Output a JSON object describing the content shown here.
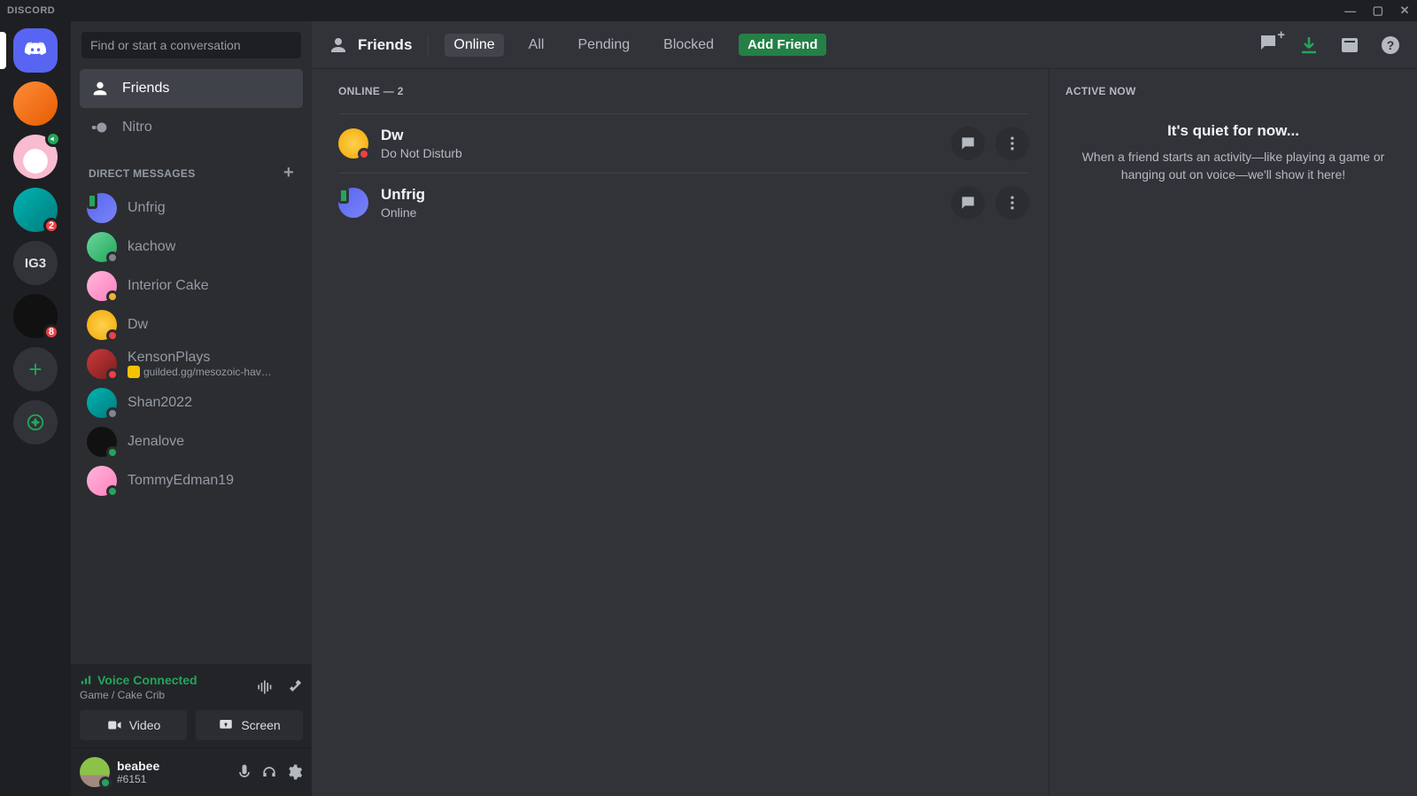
{
  "titlebar": {
    "brand": "DISCORD"
  },
  "search": {
    "placeholder": "Find or start a conversation"
  },
  "sidebar": {
    "friends_label": "Friends",
    "nitro_label": "Nitro",
    "dm_header": "DIRECT MESSAGES",
    "dms": [
      {
        "name": "Unfrig",
        "status": "mobile",
        "av": "av-blue"
      },
      {
        "name": "kachow",
        "status": "offline",
        "av": "av-green"
      },
      {
        "name": "Interior Cake",
        "status": "idle",
        "av": "av-pink"
      },
      {
        "name": "Dw",
        "status": "dnd",
        "av": "av-yellow"
      },
      {
        "name": "KensonPlays",
        "status": "dnd",
        "sub": "guilded.gg/mesozoic-hav…",
        "av": "av-red"
      },
      {
        "name": "Shan2022",
        "status": "offline",
        "av": "av-teal"
      },
      {
        "name": "Jenalove",
        "status": "online",
        "av": "av-dark"
      },
      {
        "name": "TommyEdman19",
        "status": "online",
        "av": "av-pink"
      }
    ]
  },
  "servers": [
    {
      "kind": "home",
      "active": true
    },
    {
      "kind": "icon",
      "av": "av-orange"
    },
    {
      "kind": "icon",
      "av": "av-cake",
      "voice": true
    },
    {
      "kind": "icon",
      "av": "av-teal",
      "badge": "2"
    },
    {
      "kind": "text",
      "label": "IG3"
    },
    {
      "kind": "icon",
      "av": "av-dark",
      "badge": "8"
    },
    {
      "kind": "add"
    },
    {
      "kind": "explore"
    }
  ],
  "voice": {
    "status": "Voice Connected",
    "channel": "Game / Cake Crib",
    "video_label": "Video",
    "screen_label": "Screen"
  },
  "user": {
    "name": "beabee",
    "tag": "#6151"
  },
  "header": {
    "title": "Friends",
    "tabs": {
      "online": "Online",
      "all": "All",
      "pending": "Pending",
      "blocked": "Blocked"
    },
    "add_friend": "Add Friend"
  },
  "friends": {
    "section_label": "ONLINE — 2",
    "list": [
      {
        "name": "Dw",
        "status_text": "Do Not Disturb",
        "status": "dnd",
        "av": "av-yellow"
      },
      {
        "name": "Unfrig",
        "status_text": "Online",
        "status": "mobile",
        "av": "av-blue"
      }
    ]
  },
  "activity": {
    "header": "ACTIVE NOW",
    "title": "It's quiet for now...",
    "desc": "When a friend starts an activity—like playing a game or hanging out on voice—we'll show it here!"
  }
}
